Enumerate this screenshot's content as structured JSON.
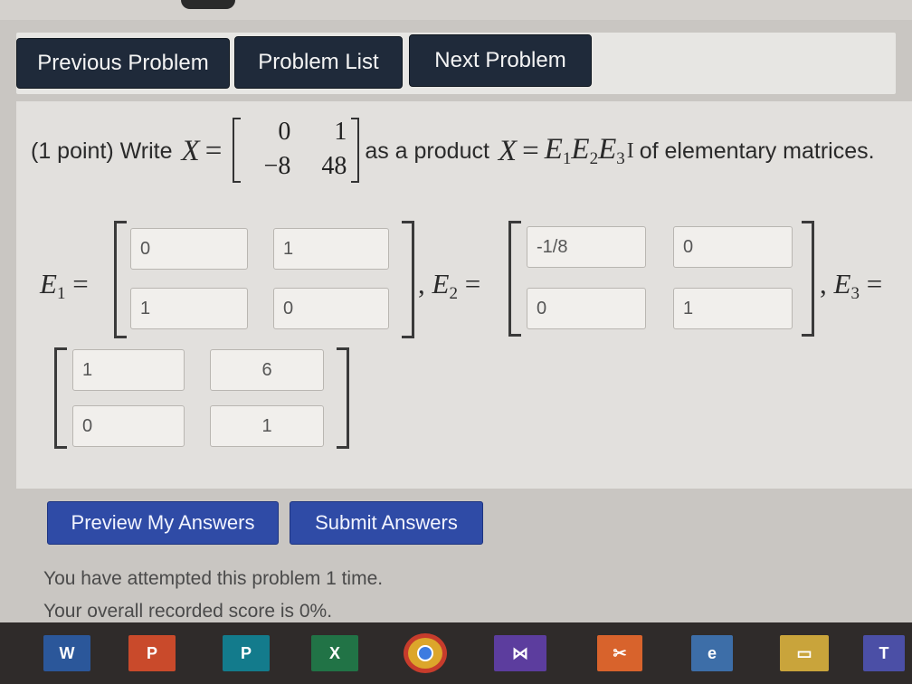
{
  "nav": {
    "previous": "Previous Problem",
    "list": "Problem List",
    "next": "Next Problem"
  },
  "problem": {
    "points": "(1 point) Write",
    "var_x": "X",
    "equals": "=",
    "x_matrix": [
      "0",
      "1",
      "−8",
      "48"
    ],
    "as_product": "as a product",
    "e1": "E",
    "e2": "E",
    "e3": "E",
    "sub1": "1",
    "sub2": "2",
    "sub3": "3",
    "of_text": "of elementary matrices.",
    "comma": ","
  },
  "answers": {
    "E1": [
      "0",
      "1",
      "1",
      "0"
    ],
    "E2": [
      "-1/8",
      "0",
      "0",
      "1"
    ],
    "E3": [
      "1",
      "6",
      "0",
      "1"
    ]
  },
  "buttons": {
    "preview": "Preview My Answers",
    "submit": "Submit Answers"
  },
  "status": {
    "attempted": "You have attempted this problem 1 time.",
    "score": "Your overall recorded score is 0%."
  },
  "taskbar": {
    "word": "W",
    "powerpoint": "P",
    "publisher": "P",
    "excel": "X",
    "teams": "T"
  },
  "colors": {
    "nav_button": "#1f2a3a",
    "action_button": "#2f4ba6",
    "taskbar": "#2f2b2a"
  }
}
